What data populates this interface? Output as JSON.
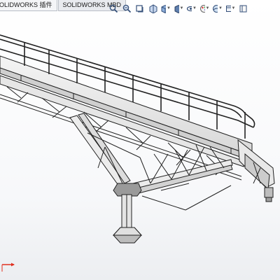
{
  "tabs": [
    {
      "label": "OLIDWORKS 插件",
      "active": true
    },
    {
      "label": "SOLIDWORKS MBD",
      "active": false
    }
  ],
  "view_toolbar": {
    "icons": [
      "zoom-to-fit-icon",
      "zoom-to-area-icon",
      "previous-view-icon",
      "section-view-icon",
      "view-orientation-icon",
      "display-style-icon",
      "hide-show-items-icon",
      "edit-appearance-icon",
      "apply-scene-icon",
      "view-settings-icon",
      "display-pane-icon"
    ]
  },
  "colors": {
    "background": "#ffffff",
    "model_fill": "#e9e9e9",
    "model_edge": "#222222",
    "triad_x": "#e03020"
  }
}
